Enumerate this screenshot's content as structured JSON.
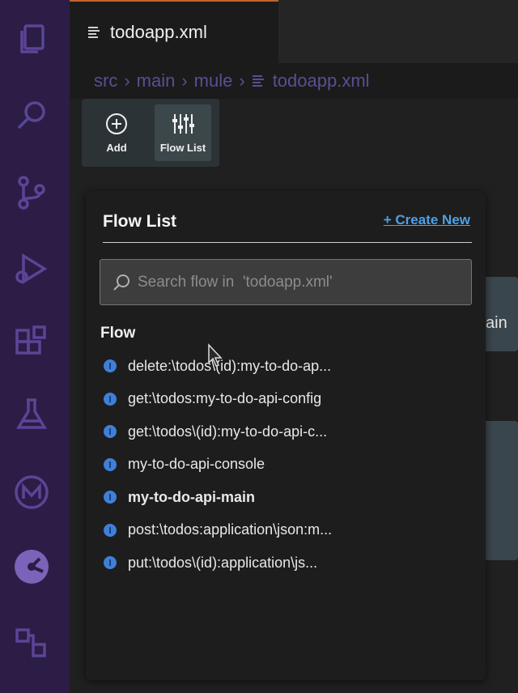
{
  "tab": {
    "label": "todoapp.xml"
  },
  "breadcrumb": [
    "src",
    "main",
    "mule",
    "todoapp.xml"
  ],
  "toolbar": {
    "add_label": "Add",
    "flow_list_label": "Flow List"
  },
  "canvas": {
    "partial_text": "ain"
  },
  "panel": {
    "title": "Flow List",
    "create_new_label": "+ Create New",
    "search_placeholder": "Search flow in  'todoapp.xml'",
    "section_label": "Flow",
    "flows": [
      {
        "label": "delete:\\todos\\(id):my-to-do-ap...",
        "bold": false
      },
      {
        "label": "get:\\todos:my-to-do-api-config",
        "bold": false
      },
      {
        "label": "get:\\todos\\(id):my-to-do-api-c...",
        "bold": false
      },
      {
        "label": "my-to-do-api-console",
        "bold": false
      },
      {
        "label": "my-to-do-api-main",
        "bold": true
      },
      {
        "label": "post:\\todos:application\\json:m...",
        "bold": false
      },
      {
        "label": "put:\\todos\\(id):application\\js...",
        "bold": false
      }
    ]
  },
  "activity_bar": {
    "icons": [
      "explorer-icon",
      "search-icon",
      "source-control-icon",
      "run-debug-icon",
      "extensions-icon",
      "testing-icon",
      "mulesoft-icon",
      "api-icon",
      "remote-icon"
    ]
  },
  "colors": {
    "activity_bar_bg": "#2b1d45",
    "activity_icon": "#5a4596",
    "accent_link": "#4ea0e8",
    "tab_top_border": "#c2632c"
  }
}
